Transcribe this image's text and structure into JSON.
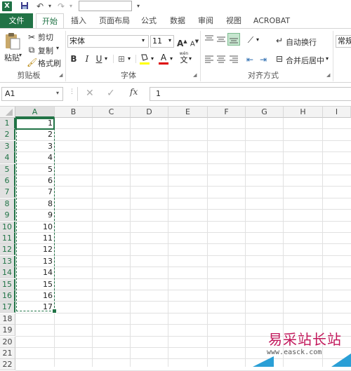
{
  "title_bar": {
    "app_icon": "X",
    "quick_access": [
      "save-icon",
      "undo-icon",
      "redo-icon"
    ]
  },
  "tabs": [
    {
      "label": "文件"
    },
    {
      "label": "开始"
    },
    {
      "label": "插入"
    },
    {
      "label": "页面布局"
    },
    {
      "label": "公式"
    },
    {
      "label": "数据"
    },
    {
      "label": "审阅"
    },
    {
      "label": "视图"
    },
    {
      "label": "ACROBAT"
    }
  ],
  "ribbon": {
    "clipboard": {
      "paste": "粘贴",
      "cut": "剪切",
      "copy": "复制",
      "format_painter": "格式刷",
      "group_label": "剪贴板"
    },
    "font": {
      "font_name": "宋体",
      "font_size": "11",
      "bold": "B",
      "italic": "I",
      "underline": "U",
      "grow": "A",
      "shrink": "A",
      "font_color_glyph": "A",
      "wen": "wén",
      "wen_char": "文",
      "group_label": "字体"
    },
    "alignment": {
      "wrap_text": "自动换行",
      "merge_center": "合并后居中",
      "group_label": "对齐方式"
    },
    "number": {
      "format": "常规"
    }
  },
  "formula_bar": {
    "name_box": "A1",
    "fx": "fx",
    "content": "1"
  },
  "columns": [
    "A",
    "B",
    "C",
    "D",
    "E",
    "F",
    "G",
    "H",
    "I"
  ],
  "rows": [
    "1",
    "2",
    "3",
    "4",
    "5",
    "6",
    "7",
    "8",
    "9",
    "10",
    "11",
    "12",
    "13",
    "14",
    "15",
    "16",
    "17",
    "18",
    "19",
    "20",
    "21",
    "22"
  ],
  "column_a_values": [
    "1",
    "2",
    "3",
    "4",
    "5",
    "6",
    "7",
    "8",
    "9",
    "10",
    "11",
    "12",
    "13",
    "14",
    "15",
    "16",
    "17"
  ],
  "watermark": {
    "title": "易采站长站",
    "url": "www.easck.com"
  },
  "colors": {
    "accent": "#217346",
    "watermark": "#c2185b"
  }
}
